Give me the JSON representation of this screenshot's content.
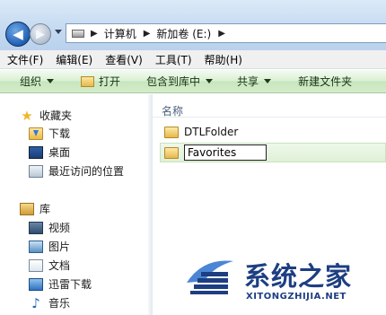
{
  "address": {
    "breadcrumbs": [
      "计算机",
      "新加卷 (E:)"
    ]
  },
  "menu": [
    "文件(F)",
    "编辑(E)",
    "查看(V)",
    "工具(T)",
    "帮助(H)"
  ],
  "commands": {
    "organize": "组织",
    "open": "打开",
    "include_in_library": "包含到库中",
    "share": "共享",
    "new_folder": "新建文件夹"
  },
  "nav": {
    "favorites_header": "收藏夹",
    "favorites": [
      "下载",
      "桌面",
      "最近访问的位置"
    ],
    "libraries_header": "库",
    "libraries": [
      "视频",
      "图片",
      "文档",
      "迅雷下载",
      "音乐"
    ]
  },
  "files": {
    "column_header": "名称",
    "items": [
      {
        "name": "DTLFolder"
      }
    ],
    "renaming_value": "Favorites"
  },
  "watermark": {
    "title": "系统之家",
    "url": "XITONGZHIJIA.NET",
    "color": "#1d3e82"
  },
  "colors": {
    "command_bar": "#d3ecc9",
    "address_bar": "#c9ddf2"
  }
}
